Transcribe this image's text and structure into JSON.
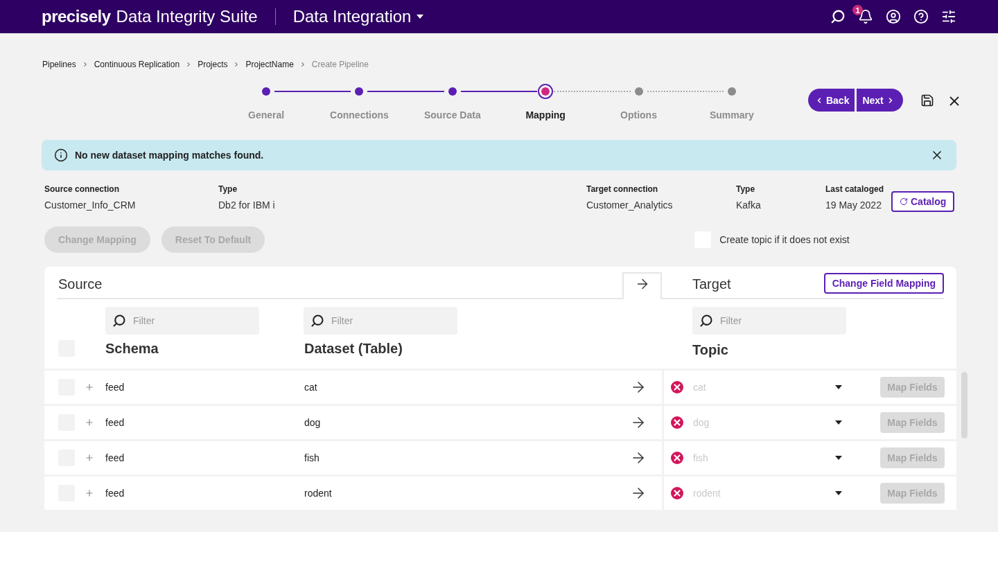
{
  "header": {
    "logo": "precisely",
    "suite": "Data Integrity Suite",
    "product": "Data Integration",
    "notification_count": "1"
  },
  "breadcrumbs": [
    {
      "label": "Pipelines",
      "current": false
    },
    {
      "label": "Continuous Replication",
      "current": false
    },
    {
      "label": "Projects",
      "current": false
    },
    {
      "label": "ProjectName",
      "current": false
    },
    {
      "label": "Create Pipeline",
      "current": true
    }
  ],
  "steps": [
    {
      "label": "General",
      "completed": true,
      "selected": false
    },
    {
      "label": "Connections",
      "completed": true,
      "selected": false
    },
    {
      "label": "Source Data",
      "completed": true,
      "selected": false
    },
    {
      "label": "Mapping",
      "completed": false,
      "selected": true
    },
    {
      "label": "Options",
      "completed": false,
      "selected": false
    },
    {
      "label": "Summary",
      "completed": false,
      "selected": false
    }
  ],
  "nav_buttons": {
    "back": "Back",
    "next": "Next"
  },
  "alert": {
    "message": "No new dataset mapping matches found."
  },
  "info": [
    {
      "label": "Source connection",
      "value": "Customer_Info_CRM"
    },
    {
      "label": "Type",
      "value": "Db2 for IBM i"
    },
    {
      "label": "Target connection",
      "value": "Customer_Analytics"
    },
    {
      "label": "Type",
      "value": "Kafka"
    },
    {
      "label": "Last cataloged",
      "value": "19 May 2022"
    }
  ],
  "catalog_button": "Catalog",
  "actions": [
    {
      "label": "Change Mapping",
      "disabled": true
    },
    {
      "label": "Reset To Default",
      "disabled": true
    }
  ],
  "create_topic": {
    "label": "Create topic if it does not exist",
    "checked": false
  },
  "mapping": {
    "source_title": "Source",
    "target_title": "Target",
    "change_field_mapping": "Change Field Mapping",
    "filters": [
      {
        "placeholder": "Filter"
      },
      {
        "placeholder": "Filter"
      },
      {
        "placeholder": "Filter"
      }
    ],
    "select_all": {
      "checked": false
    },
    "columns": [
      "Schema",
      "Dataset (Table)",
      "Topic"
    ],
    "rows": [
      {
        "checked": false,
        "schema": "feed",
        "dataset": "cat",
        "error": true,
        "topic_placeholder": "cat",
        "map_fields": "Map Fields",
        "map_fields_disabled": true
      },
      {
        "checked": false,
        "schema": "feed",
        "dataset": "dog",
        "error": true,
        "topic_placeholder": "dog",
        "map_fields": "Map Fields",
        "map_fields_disabled": true
      },
      {
        "checked": false,
        "schema": "feed",
        "dataset": "fish",
        "error": true,
        "topic_placeholder": "fish",
        "map_fields": "Map Fields",
        "map_fields_disabled": true
      },
      {
        "checked": false,
        "schema": "feed",
        "dataset": "rodent",
        "error": true,
        "topic_placeholder": "rodent",
        "map_fields": "Map Fields",
        "map_fields_disabled": true
      }
    ]
  }
}
